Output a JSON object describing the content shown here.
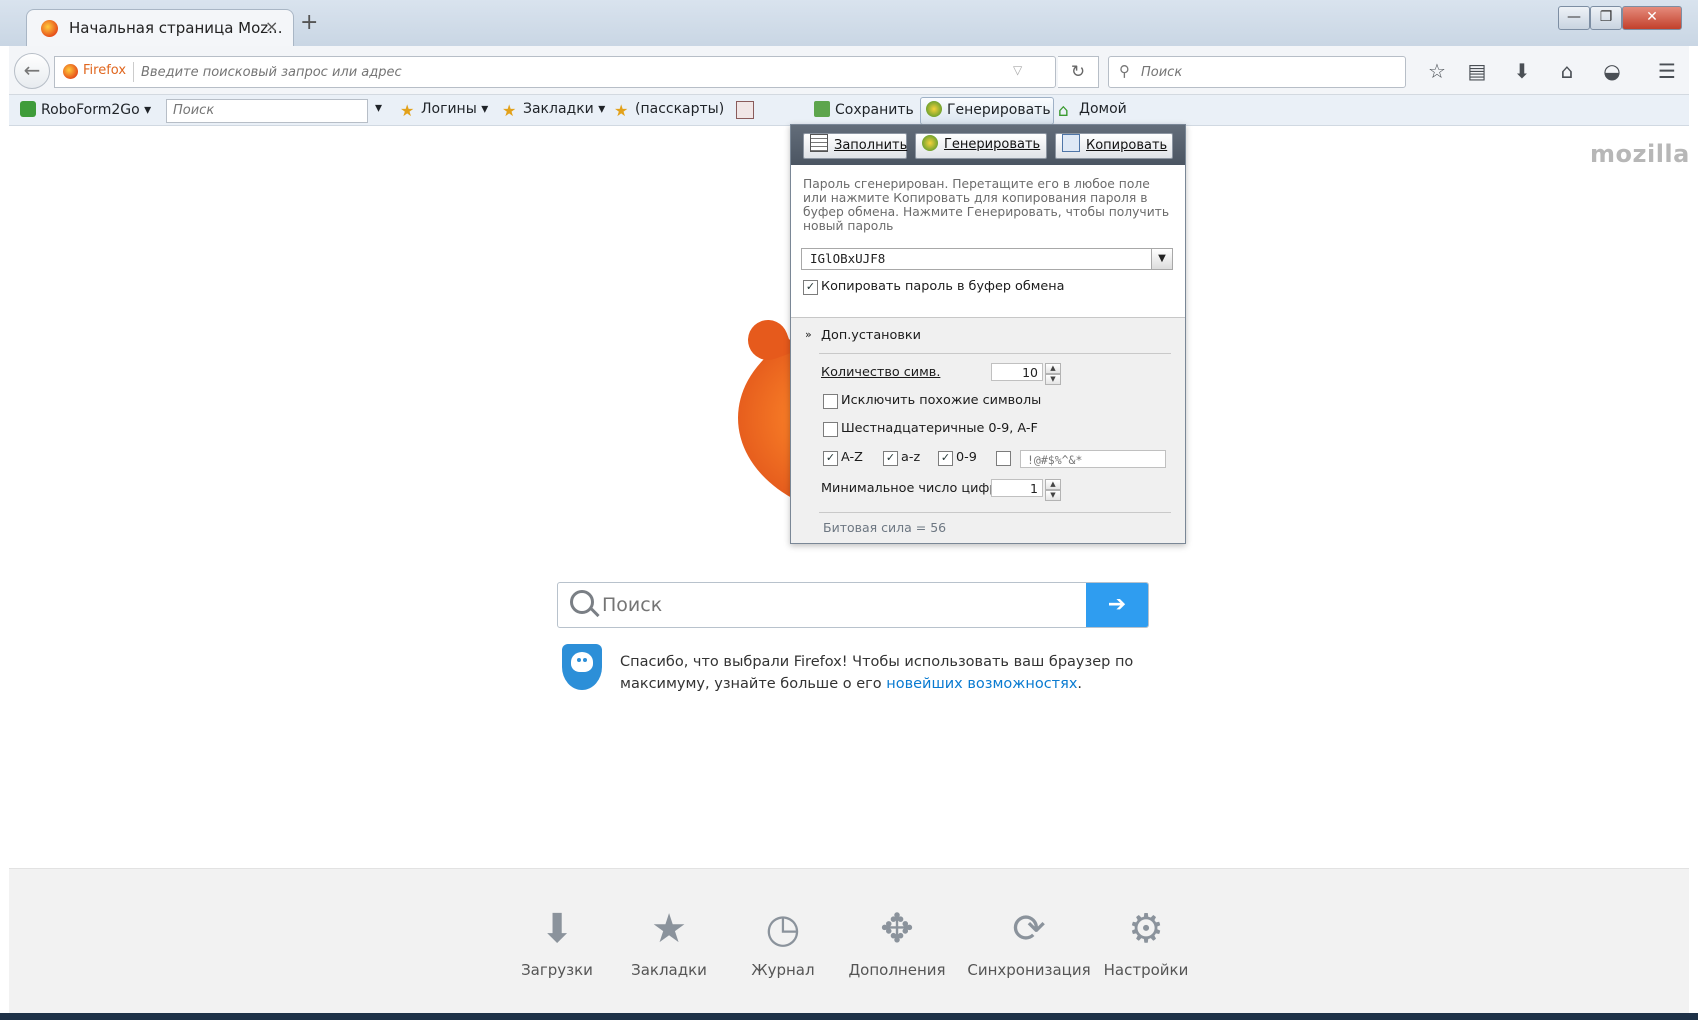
{
  "browser": {
    "tab_title": "Начальная страница Moz...",
    "tab_close": "×",
    "new_tab": "+",
    "window_buttons": {
      "minimize": "—",
      "restore": "❐",
      "close": "✕"
    }
  },
  "navbar": {
    "identity_label": "Firefox",
    "url_placeholder": "Введите поисковый запрос или адрес",
    "search_placeholder": "Поиск"
  },
  "toolbar": {
    "roboform": "RoboForm2Go ▾",
    "search_placeholder": "Поиск",
    "logins": "Логины ▾",
    "bookmarks": "Закладки ▾",
    "passcards": "(пасскарты)",
    "save": "Сохранить",
    "generate": "Генерировать",
    "home": "Домой"
  },
  "popup": {
    "fill": "Заполнить",
    "generate": "Генерировать",
    "copy": "Копировать",
    "hint": "Пароль сгенерирован. Перетащите его в любое поле или нажмите Копировать для копирования пароля в буфер обмена. Нажмите Генерировать, чтобы получить новый пароль",
    "password": "IGlOBxUJF8",
    "copy_to_clipboard": "Копировать пароль в буфер обмена",
    "advanced": "Доп.установки",
    "length_label": "Количество симв.",
    "length_value": "10",
    "exclude_similar": "Исключить похожие символы",
    "hex": "Шестнадцатеричные 0-9, A-F",
    "upper": "A-Z",
    "lower": "a-z",
    "digits": "0-9",
    "specials": "!@#$%^&*",
    "min_digits_label": "Минимальное число цифр:",
    "min_digits_value": "1",
    "strength": "Битовая сила = 56"
  },
  "page": {
    "brand": "mozilla",
    "search_placeholder": "Поиск",
    "go": "➔",
    "promo_text": "Спасибо, что выбрали Firefox! Чтобы использовать ваш браузер по максимуму, узнайте больше о его",
    "promo_link": "новейших возможностях",
    "promo_end": "."
  },
  "launcher": [
    {
      "label": "Загрузки",
      "icon": "downloads-icon"
    },
    {
      "label": "Закладки",
      "icon": "bookmarks-icon"
    },
    {
      "label": "Журнал",
      "icon": "history-icon"
    },
    {
      "label": "Дополнения",
      "icon": "addons-icon"
    },
    {
      "label": "Синхронизация",
      "icon": "sync-icon"
    },
    {
      "label": "Настройки",
      "icon": "settings-icon"
    }
  ],
  "colors": {
    "accent": "#2f9df0",
    "link": "#0a7bd1",
    "firefox_orange": "#e6501b"
  }
}
